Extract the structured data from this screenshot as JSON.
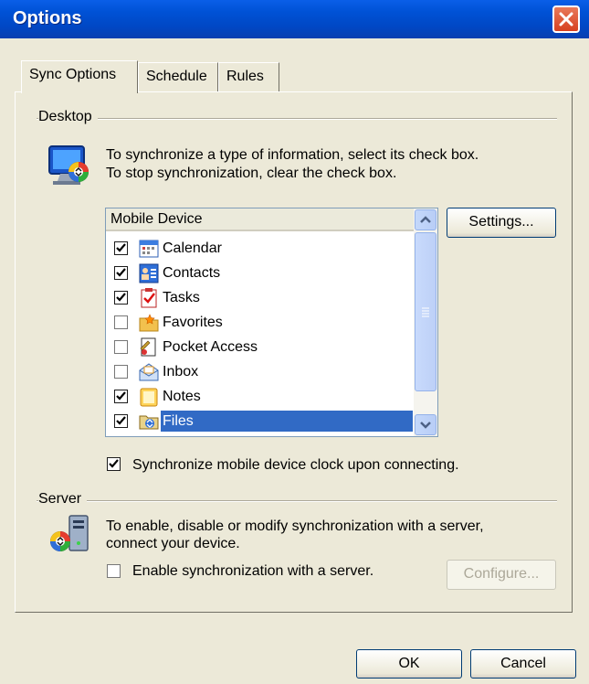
{
  "window": {
    "title": "Options"
  },
  "tabs": [
    {
      "label": "Sync Options",
      "active": true
    },
    {
      "label": "Schedule",
      "active": false
    },
    {
      "label": "Rules",
      "active": false
    }
  ],
  "desktop": {
    "group_label": "Desktop",
    "instructions_line1": "To synchronize a type of information, select its check box.",
    "instructions_line2": "To stop synchronization, clear the check box.",
    "list_header": "Mobile Device",
    "items": [
      {
        "label": "Calendar",
        "checked": true,
        "icon": "calendar-icon"
      },
      {
        "label": "Contacts",
        "checked": true,
        "icon": "contacts-icon"
      },
      {
        "label": "Tasks",
        "checked": true,
        "icon": "tasks-icon"
      },
      {
        "label": "Favorites",
        "checked": false,
        "icon": "favorites-icon"
      },
      {
        "label": "Pocket Access",
        "checked": false,
        "icon": "pocket-access-icon"
      },
      {
        "label": "Inbox",
        "checked": false,
        "icon": "inbox-icon"
      },
      {
        "label": "Notes",
        "checked": true,
        "icon": "notes-icon"
      },
      {
        "label": "Files",
        "checked": true,
        "icon": "files-icon",
        "selected": true
      }
    ],
    "settings_button": "Settings...",
    "sync_clock_label": "Synchronize mobile device clock upon connecting.",
    "sync_clock_checked": true
  },
  "server": {
    "group_label": "Server",
    "instructions_line1": "To enable, disable or modify synchronization with a server,",
    "instructions_line2": "connect your device.",
    "enable_label": "Enable synchronization with a server.",
    "enable_checked": false,
    "configure_button": "Configure..."
  },
  "footer": {
    "ok_button": "OK",
    "cancel_button": "Cancel"
  },
  "colors": {
    "titlebar": "#0052d6",
    "selection": "#316ac5",
    "dialog_bg": "#ece9d8"
  }
}
